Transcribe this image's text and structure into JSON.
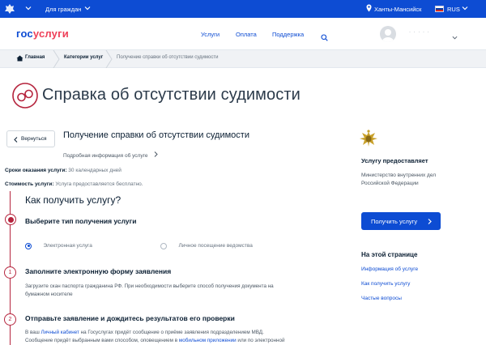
{
  "topbar": {
    "audience": "Для граждан",
    "location": "Ханты-Мансийск",
    "language": "RUS"
  },
  "header": {
    "logo_part1": "гос",
    "logo_part2": "услуги",
    "nav": [
      "Услуги",
      "Оплата",
      "Поддержка"
    ],
    "user_name": "· · · · ·"
  },
  "breadcrumbs": [
    "Главная",
    "Категории услуг",
    "Получение справки об отсутствии судимости"
  ],
  "page_title": "Справка об отсутствии судимости",
  "back_button": "Вернуться",
  "service": {
    "title": "Получение справки об отсутствии судимости",
    "details_link": "Подробная информация об услуге"
  },
  "facts": [
    {
      "label": "Сроки оказания услуги:",
      "value": "30 календарных дней"
    },
    {
      "label": "Стоимость услуги:",
      "value": "Услуга предоставляется бесплатно."
    }
  ],
  "how_title": "Как получить услугу?",
  "steps": {
    "step0": {
      "title": "Выберите тип получения услуги",
      "options": [
        "Электронная услуга",
        "Личное посещение ведомства"
      ],
      "selected_index": 0
    },
    "step1": {
      "number": "1",
      "title": "Заполните электронную форму заявления",
      "text_line1": "Загрузите скан паспорта гражданина РФ. При необходимости выберите способ получения документа на",
      "text_line2": "бумажном носителе"
    },
    "step2": {
      "number": "2",
      "title": "Отправьте заявление и дождитесь результатов его проверки",
      "line1_a": "В ваш ",
      "line1_link": "Личный кабинет",
      "line1_b": " на Госуслугах придёт сообщение о приёме заявления подразделением МВД.",
      "line2_a": "Сообщение придёт выбранным вами способом, оповещением в ",
      "line2_link": "мобильном приложении",
      "line2_b": " или по электронной"
    }
  },
  "sidebar": {
    "provider_label": "Услугу предоставляет",
    "provider_name_line1": "Министерство внутренних дел",
    "provider_name_line2": "Российской Федерации",
    "cta_label": "Получить услугу",
    "on_page_title": "На этой странице",
    "on_page_links": [
      "Информация об услуге",
      "Как получить услугу",
      "Частые вопросы"
    ]
  },
  "colors": {
    "brand_blue": "#0d4cd3",
    "brand_red": "#ee3f58",
    "step_accent": "#b5243d"
  }
}
